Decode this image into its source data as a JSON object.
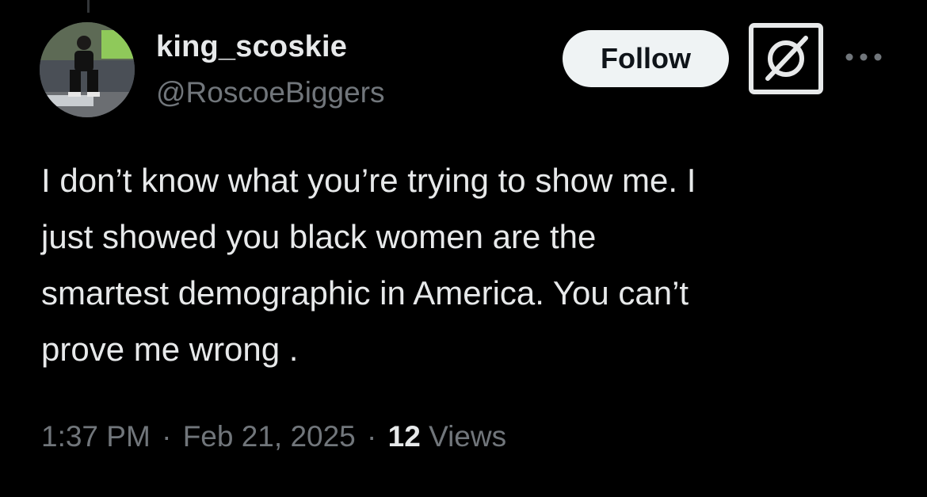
{
  "author": {
    "display_name": "king_scoskie",
    "handle": "@RoscoeBiggers"
  },
  "actions": {
    "follow_label": "Follow"
  },
  "tweet": {
    "lines": [
      "I don’t know what you’re trying to show me. I",
      "just showed you black women are the",
      "smartest demographic in America. You can’t",
      "prove me wrong ."
    ],
    "time": "1:37 PM",
    "date": "Feb 21, 2025",
    "separator": "·",
    "views_count": "12",
    "views_label": "Views"
  },
  "icons": {
    "grok": "grok-icon",
    "more": "more-dots-icon"
  },
  "colors": {
    "background": "#000000",
    "text_primary": "#e7e9ea",
    "text_secondary": "#71767b",
    "button_bg": "#eff3f4",
    "button_text": "#0f1419"
  }
}
